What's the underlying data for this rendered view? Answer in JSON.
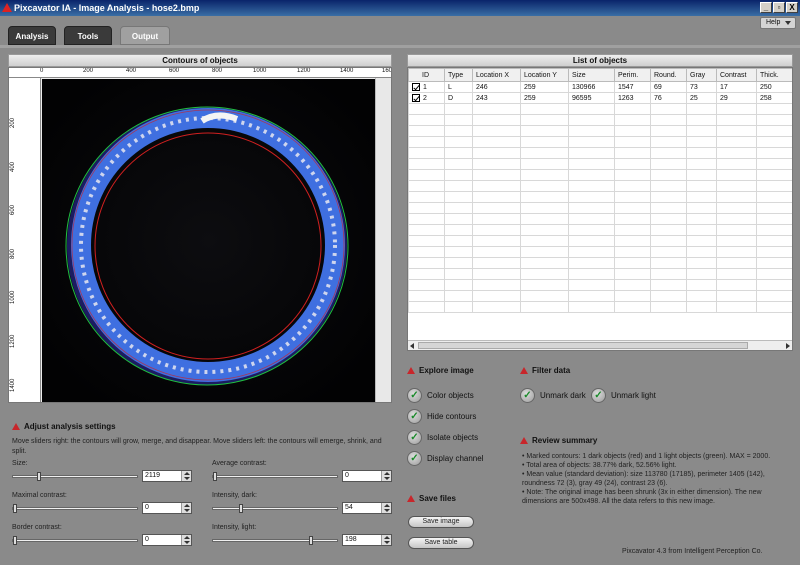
{
  "window": {
    "title": "Pixcavator IA - Image Analysis - hose2.bmp",
    "controls": [
      "_",
      "▫",
      "X"
    ]
  },
  "menu": {
    "help": "Help"
  },
  "tabs": [
    {
      "label": "Analysis"
    },
    {
      "label": "Tools"
    },
    {
      "label": "Output"
    }
  ],
  "contours": {
    "title": "Contours of objects",
    "x_ticks": [
      "0",
      "200",
      "400",
      "600",
      "800",
      "1000",
      "1200",
      "1400",
      "160"
    ],
    "y_ticks": [
      "200",
      "400",
      "600",
      "800",
      "1000",
      "1200",
      "1400"
    ]
  },
  "objects": {
    "title": "List of objects",
    "columns": [
      "ID",
      "Type",
      "Location X",
      "Location Y",
      "Size",
      "Perim.",
      "Round.",
      "Gray",
      "Contrast",
      "Thick."
    ],
    "rows": [
      {
        "checked": true,
        "id": "1",
        "type": "L",
        "loc_x": "246",
        "loc_y": "259",
        "size": "130966",
        "perim": "1547",
        "round": "69",
        "gray": "73",
        "contrast": "17",
        "thick": "250"
      },
      {
        "checked": true,
        "id": "2",
        "type": "D",
        "loc_x": "243",
        "loc_y": "259",
        "size": "96595",
        "perim": "1263",
        "round": "76",
        "gray": "25",
        "contrast": "29",
        "thick": "258"
      }
    ]
  },
  "explore": {
    "title": "Explore image",
    "buttons": [
      "Color objects",
      "Hide contours",
      "Isolate objects",
      "Display channel"
    ]
  },
  "filter": {
    "title": "Filter data",
    "buttons": [
      "Unmark dark",
      "Unmark light"
    ]
  },
  "save": {
    "title": "Save files",
    "save_image": "Save image",
    "save_table": "Save table"
  },
  "adjust": {
    "title": "Adjust analysis settings",
    "description": "Move sliders right: the contours will grow, merge, and disappear. Move sliders left: the contours will emerge, shrink, and split.",
    "size": {
      "label": "Size:",
      "value": "2119"
    },
    "avg_contrast": {
      "label": "Average contrast:",
      "value": "0"
    },
    "max_contrast": {
      "label": "Maximal contrast:",
      "value": "0"
    },
    "int_dark": {
      "label": "Intensity, dark:",
      "value": "54"
    },
    "border_contrast": {
      "label": "Border contrast:",
      "value": "0"
    },
    "int_light": {
      "label": "Intensity, light:",
      "value": "198"
    }
  },
  "review": {
    "title": "Review summary",
    "lines": [
      "• Marked contours: 1 dark objects (red) and 1 light objects (green). MAX = 2000.",
      "• Total area of objects: 38.77% dark, 52.56% light.",
      "• Mean value (standard deviation): size 113780 (17185), perimeter 1405 (142), roundness 72 (3), gray 49 (24), contrast 23 (6).",
      "• Note: The original image has been shrunk (3x in either dimension). The new dimensions are 500x498. All the data refers to this new image."
    ]
  },
  "footer": "Pixcavator 4.3 from Intelligent Perception Co.",
  "colors": {
    "dark_contour": "#d02020",
    "light_contour": "#20c040",
    "hose": "#2f5fd0"
  }
}
